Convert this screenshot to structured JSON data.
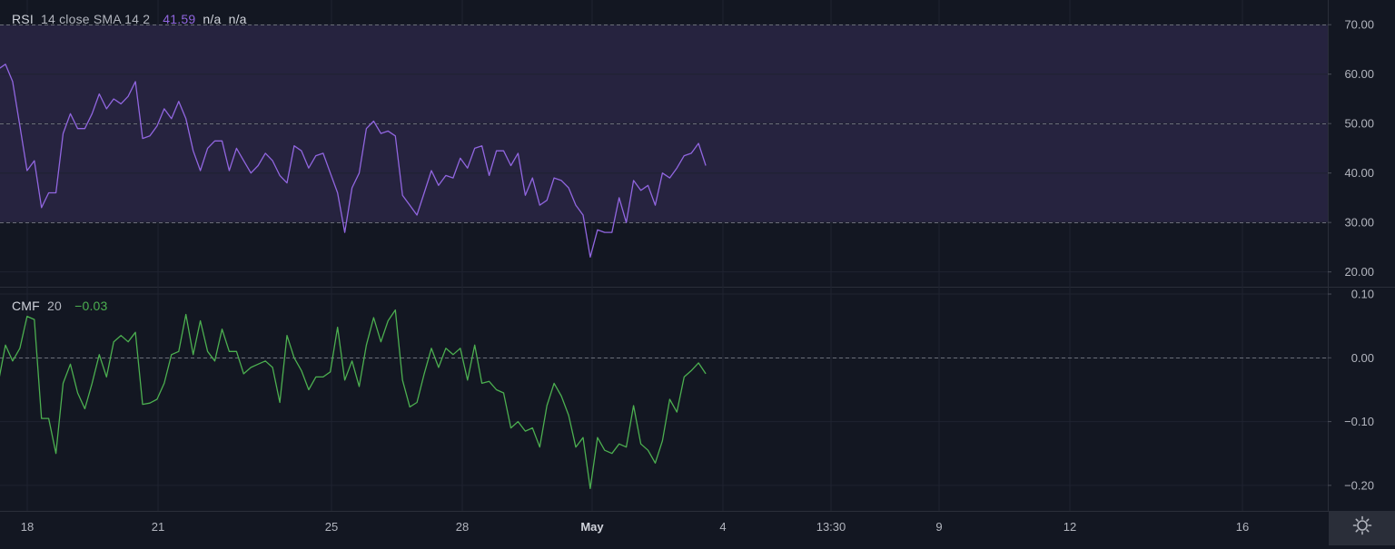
{
  "rsi_legend": {
    "name": "RSI",
    "params": "14 close SMA 14 2",
    "value": "41.59",
    "na1": "n/a",
    "na2": "n/a"
  },
  "cmf_legend": {
    "name": "CMF",
    "params": "20",
    "value": "−0.03"
  },
  "colors": {
    "background": "#131722",
    "rsi_line": "#9166e0",
    "rsi_band": "#26233f",
    "cmf_line": "#4caf50",
    "cmf_value": "#4caf50",
    "rsi_value": "#9166e0",
    "grid": "#1f2330",
    "dashed": "#6b6e78"
  },
  "icons": {
    "settings": "gear-icon"
  },
  "chart_data": [
    {
      "type": "line",
      "title": "RSI 14 close SMA 14 2",
      "ylim": [
        17,
        75
      ],
      "y_ticks": [
        "70.00",
        "60.00",
        "50.00",
        "40.00",
        "30.00",
        "20.00"
      ],
      "y_tick_values": [
        70,
        60,
        50,
        40,
        30,
        20
      ],
      "band": [
        30,
        70
      ],
      "dashed_levels": [
        70,
        50,
        30
      ],
      "series": [
        {
          "name": "RSI",
          "values": [
            61,
            62,
            58.5,
            49.5,
            40.5,
            42.5,
            33,
            36,
            36,
            48,
            52,
            49,
            49,
            52,
            56,
            53,
            55,
            54,
            55.5,
            58.5,
            47,
            47.5,
            49.5,
            53,
            51,
            54.5,
            51,
            44.5,
            40.5,
            45,
            46.5,
            46.5,
            40.5,
            45,
            42.5,
            40,
            41.5,
            44,
            42.5,
            39.5,
            38,
            45.5,
            44.5,
            41,
            43.5,
            44,
            40,
            36,
            28,
            37,
            40,
            49,
            50.5,
            48,
            48.5,
            47.5,
            35.5,
            33.5,
            31.5,
            36,
            40.5,
            37.5,
            39.5,
            39,
            43,
            41,
            45,
            45.5,
            39.5,
            44.5,
            44.5,
            41.5,
            44,
            35.5,
            39,
            33.5,
            34.5,
            39,
            38.5,
            37,
            33.5,
            31.5,
            23,
            28.5,
            28,
            28,
            35,
            30,
            38.5,
            36.5,
            37.5,
            33.5,
            40,
            39,
            41,
            43.5,
            44,
            46,
            41.5
          ]
        }
      ]
    },
    {
      "type": "line",
      "title": "CMF 20",
      "ylim": [
        -0.24,
        0.11
      ],
      "y_ticks": [
        "0.10",
        "0.00",
        "−0.10",
        "−0.20"
      ],
      "y_tick_values": [
        0.1,
        0.0,
        -0.1,
        -0.2
      ],
      "dashed_levels": [
        0.0
      ],
      "series": [
        {
          "name": "CMF",
          "values": [
            -0.04,
            0.02,
            -0.005,
            0.015,
            0.065,
            0.06,
            -0.095,
            -0.095,
            -0.15,
            -0.04,
            -0.01,
            -0.055,
            -0.08,
            -0.04,
            0.005,
            -0.03,
            0.025,
            0.035,
            0.025,
            0.04,
            -0.073,
            -0.071,
            -0.065,
            -0.04,
            0.005,
            0.01,
            0.068,
            0.005,
            0.058,
            0.01,
            -0.005,
            0.045,
            0.01,
            0.01,
            -0.025,
            -0.015,
            -0.01,
            -0.005,
            -0.015,
            -0.07,
            0.035,
            0.0,
            -0.02,
            -0.05,
            -0.03,
            -0.03,
            -0.022,
            0.048,
            -0.035,
            -0.005,
            -0.045,
            0.02,
            0.063,
            0.025,
            0.058,
            0.075,
            -0.035,
            -0.077,
            -0.07,
            -0.025,
            0.015,
            -0.015,
            0.015,
            0.005,
            0.015,
            -0.035,
            0.02,
            -0.04,
            -0.037,
            -0.05,
            -0.055,
            -0.11,
            -0.1,
            -0.115,
            -0.11,
            -0.14,
            -0.075,
            -0.04,
            -0.06,
            -0.09,
            -0.14,
            -0.125,
            -0.205,
            -0.125,
            -0.145,
            -0.15,
            -0.135,
            -0.14,
            -0.075,
            -0.135,
            -0.145,
            -0.165,
            -0.13,
            -0.065,
            -0.085,
            -0.03,
            -0.02,
            -0.008,
            -0.025
          ]
        }
      ]
    }
  ],
  "x_axis": {
    "ticks": [
      {
        "label": "18",
        "bold": false,
        "pos": 30
      },
      {
        "label": "21",
        "bold": false,
        "pos": 174
      },
      {
        "label": "25",
        "bold": false,
        "pos": 365
      },
      {
        "label": "28",
        "bold": false,
        "pos": 509
      },
      {
        "label": "May",
        "bold": true,
        "pos": 652
      },
      {
        "label": "4",
        "bold": false,
        "pos": 796
      },
      {
        "label": "13:30",
        "bold": false,
        "pos": 915
      },
      {
        "label": "9",
        "bold": false,
        "pos": 1034
      },
      {
        "label": "12",
        "bold": false,
        "pos": 1178
      },
      {
        "label": "16",
        "bold": false,
        "pos": 1368
      }
    ]
  }
}
